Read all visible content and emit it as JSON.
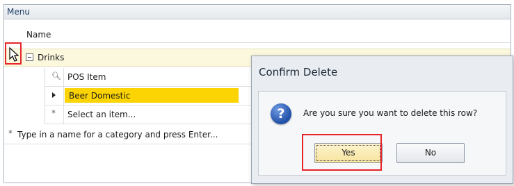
{
  "panel": {
    "title": "Menu"
  },
  "grid": {
    "column_header": "Name",
    "category_row": {
      "label": "Drinks",
      "expanded": true
    },
    "detail": {
      "column_header": "POS Item",
      "rows": [
        {
          "label": "Beer Domestic",
          "selected": true
        },
        {
          "label": "Select an item...",
          "new_row": true
        }
      ]
    },
    "new_category_row": {
      "label": "Type in a name for a category and press Enter..."
    }
  },
  "dialog": {
    "title": "Confirm Delete",
    "message": "Are you sure you want to delete this row?",
    "icon": "question-icon",
    "icon_glyph": "?",
    "buttons": {
      "yes": "Yes",
      "no": "No"
    }
  },
  "colors": {
    "highlight": "#e5252a",
    "selection": "#fcd404",
    "category_row_bg": "#fcf8de"
  }
}
